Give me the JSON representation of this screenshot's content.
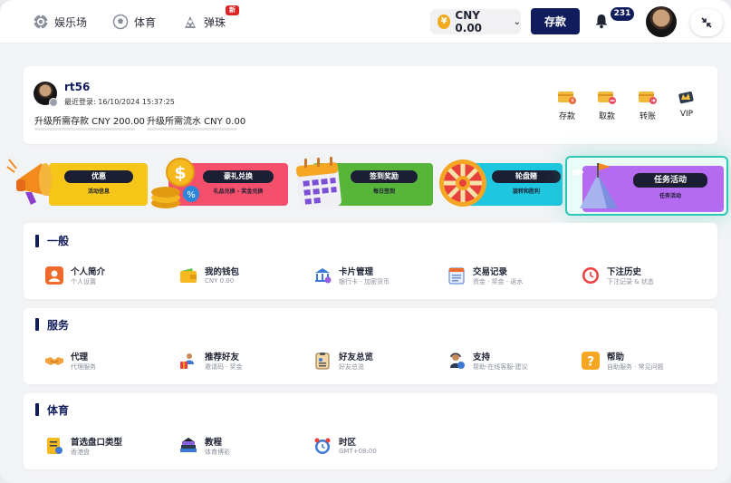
{
  "nav": {
    "items": [
      {
        "label": "娱乐场",
        "icon": "casino-chip-icon"
      },
      {
        "label": "体育",
        "icon": "soccer-ball-icon"
      },
      {
        "label": "弹珠",
        "icon": "pachinko-icon"
      }
    ],
    "new_badge": "新",
    "currency": {
      "symbol": "¥",
      "label": "CNY 0.00"
    },
    "deposit_label": "存款",
    "notification_count": "231"
  },
  "user": {
    "name": "rt56",
    "last_login": "最近登录: 16/10/2024 15:37:25",
    "deposit_required": "升级所需存款 CNY 200.00",
    "turnover_required": "升级所需流水 CNY 0.00",
    "actions": [
      {
        "label": "存款",
        "icon": "deposit-wallet-icon"
      },
      {
        "label": "取款",
        "icon": "withdraw-wallet-icon"
      },
      {
        "label": "转账",
        "icon": "transfer-wallet-icon"
      },
      {
        "label": "VIP",
        "icon": "vip-crown-icon"
      }
    ]
  },
  "promos": [
    {
      "title": "优惠",
      "sub": "活动信息",
      "color": "#f5c518",
      "icon": "megaphone-icon"
    },
    {
      "title": "豪礼兑换",
      "sub": "礼品兑换 - 奖金兑换",
      "color": "#f4506b",
      "icon": "coin-stack-icon"
    },
    {
      "title": "签到奖励",
      "sub": "每日签到",
      "color": "#57b53a",
      "icon": "calendar-icon"
    },
    {
      "title": "轮盘赌",
      "sub": "旋转和胜利",
      "color": "#1ec6e0",
      "icon": "prize-wheel-icon"
    },
    {
      "title": "任务活动",
      "sub": "任务活动",
      "color": "#b46bf2",
      "icon": "mission-flag-icon"
    }
  ],
  "sections": [
    {
      "title": "一般",
      "items": [
        {
          "title": "个人简介",
          "sub": "个人设置",
          "icon": "profile-icon"
        },
        {
          "title": "我的钱包",
          "sub": "CNY 0.00",
          "icon": "wallet-icon"
        },
        {
          "title": "卡片管理",
          "sub": "银行卡 - 加密货币",
          "icon": "bank-card-icon"
        },
        {
          "title": "交易记录",
          "sub": "资金 · 奖金 · 返水",
          "icon": "transaction-record-icon"
        },
        {
          "title": "下注历史",
          "sub": "下注记录 & 状态",
          "icon": "bet-history-icon"
        }
      ]
    },
    {
      "title": "服务",
      "items": [
        {
          "title": "代理",
          "sub": "代理服务",
          "icon": "handshake-icon"
        },
        {
          "title": "推荐好友",
          "sub": "邀请码 · 奖金",
          "icon": "refer-friend-icon"
        },
        {
          "title": "好友总览",
          "sub": "好友总览",
          "icon": "friend-overview-icon"
        },
        {
          "title": "支持",
          "sub": "帮助·在线客服·建议",
          "icon": "support-agent-icon"
        },
        {
          "title": "帮助",
          "sub": "自助服务 · 常见问题",
          "icon": "help-question-icon"
        }
      ]
    },
    {
      "title": "体育",
      "items": [
        {
          "title": "首选盘口类型",
          "sub": "香港盘",
          "icon": "odds-type-icon"
        },
        {
          "title": "教程",
          "sub": "体育博彩",
          "icon": "tutorial-books-icon"
        },
        {
          "title": "时区",
          "sub": "GMT+08:00",
          "icon": "timezone-clock-icon"
        }
      ]
    }
  ]
}
